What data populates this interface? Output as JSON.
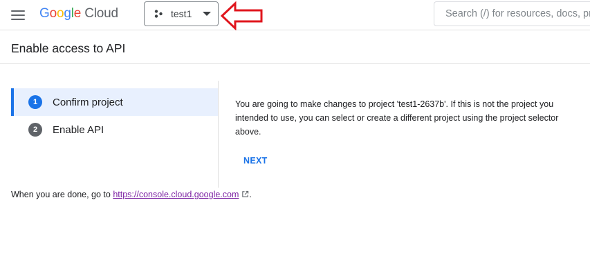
{
  "topbar": {
    "logo_google": [
      "G",
      "o",
      "o",
      "g",
      "l",
      "e"
    ],
    "logo_cloud": "Cloud",
    "project_name": "test1",
    "search_placeholder": "Search (/) for resources, docs, products, and more"
  },
  "header": {
    "title": "Enable access to API"
  },
  "stepper": {
    "steps": [
      {
        "number": "1",
        "label": "Confirm project",
        "state": "active"
      },
      {
        "number": "2",
        "label": "Enable API",
        "state": "inactive"
      }
    ]
  },
  "content": {
    "description": "You are going to make changes to project 'test1-2637b'. If this is not the project you intended to use, you can select or create a different project using the project selector above.",
    "next_label": "NEXT"
  },
  "footer": {
    "prefix": "When you are done, go to ",
    "link_text": "https://console.cloud.google.com",
    "suffix": "."
  },
  "colors": {
    "accent": "#1a73e8",
    "annotation_arrow": "#e0161d",
    "link_visited": "#7b1fa2"
  },
  "icons": [
    "menu-icon",
    "project-icon",
    "dropdown-caret-icon",
    "external-link-icon"
  ]
}
